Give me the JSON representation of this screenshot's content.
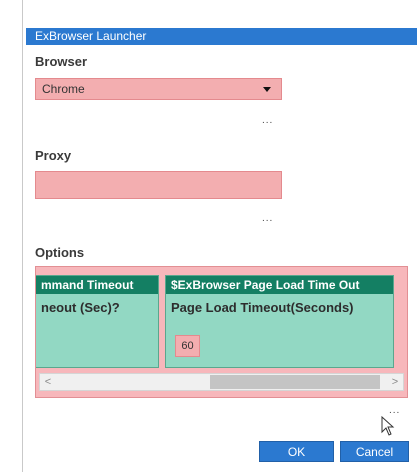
{
  "window": {
    "title": "ExBrowser Launcher"
  },
  "browser": {
    "label": "Browser",
    "selected": "Chrome",
    "more": "..."
  },
  "proxy": {
    "label": "Proxy",
    "value": "",
    "more": "..."
  },
  "options": {
    "label": "Options",
    "cards": [
      {
        "header": "mmand Timeout",
        "label": "neout (Sec)?"
      },
      {
        "header": "$ExBrowser Page Load Time Out",
        "label": "Page Load Timeout(Seconds)",
        "value": "60"
      }
    ],
    "scroll": {
      "left_arrow": "<",
      "right_arrow": ">"
    }
  },
  "footer": {
    "more": "...",
    "ok_label": "OK",
    "cancel_label": "Cancel"
  },
  "colors": {
    "accent": "#2b79d0",
    "card_header": "#147f63",
    "card_bg": "#92d8c3",
    "field_bg": "#f3aeb0"
  }
}
